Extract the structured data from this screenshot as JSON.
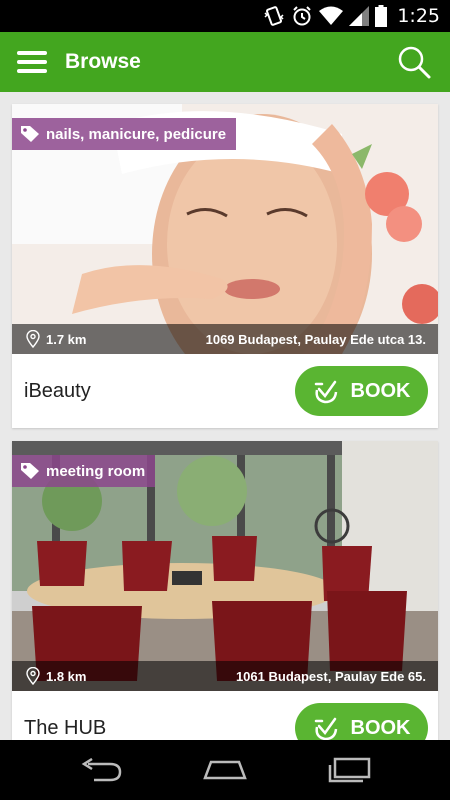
{
  "status_bar": {
    "time": "1:25",
    "icons": [
      "vibrate-icon",
      "alarm-icon",
      "wifi-icon",
      "signal-icon",
      "battery-icon"
    ]
  },
  "app_bar": {
    "title": "Browse",
    "menu_icon": "hamburger-menu-icon",
    "search_icon": "search-icon",
    "color": "#43a61f"
  },
  "listings": [
    {
      "tag": "nails, manicure, pedicure",
      "distance": "1.7 km",
      "address": "1069 Budapest, Paulay Ede utca 13.",
      "name": "iBeauty",
      "book_label": "BOOK"
    },
    {
      "tag": "meeting room",
      "distance": "1.8 km",
      "address": "1061 Budapest, Paulay Ede  65.",
      "name": "The HUB",
      "book_label": "BOOK"
    }
  ],
  "colors": {
    "tag_background": "#8c468c",
    "book_button": "#5ab532"
  },
  "nav_bar": {
    "icons": [
      "back-icon",
      "home-icon",
      "recent-apps-icon"
    ]
  }
}
